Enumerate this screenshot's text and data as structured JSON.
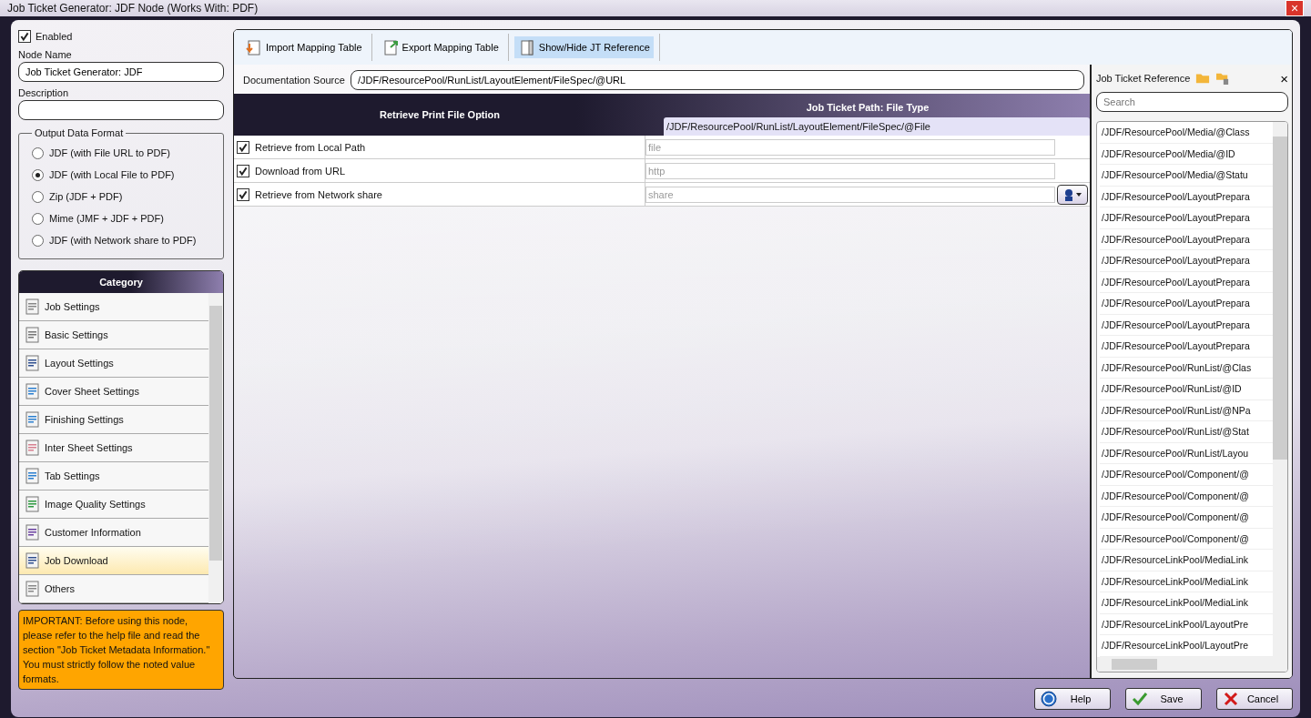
{
  "window": {
    "title": "Job Ticket Generator: JDF Node (Works With: PDF)",
    "close": "×"
  },
  "enabled": {
    "label": "Enabled",
    "checked": true
  },
  "node_name": {
    "label": "Node Name",
    "value": "Job Ticket Generator: JDF"
  },
  "description": {
    "label": "Description"
  },
  "output_format": {
    "legend": "Output Data Format",
    "options": [
      {
        "label": "JDF (with File URL to PDF)",
        "selected": false
      },
      {
        "label": "JDF (with Local File to PDF)",
        "selected": true
      },
      {
        "label": "Zip (JDF + PDF)",
        "selected": false
      },
      {
        "label": "Mime (JMF + JDF + PDF)",
        "selected": false
      },
      {
        "label": "JDF (with Network share to PDF)",
        "selected": false
      }
    ]
  },
  "category": {
    "title": "Category",
    "items": [
      {
        "label": "Job Settings",
        "selected": false
      },
      {
        "label": "Basic Settings",
        "selected": false
      },
      {
        "label": "Layout Settings",
        "selected": false
      },
      {
        "label": "Cover Sheet Settings",
        "selected": false
      },
      {
        "label": "Finishing Settings",
        "selected": false
      },
      {
        "label": "Inter Sheet Settings",
        "selected": false
      },
      {
        "label": "Tab Settings",
        "selected": false
      },
      {
        "label": "Image Quality Settings",
        "selected": false
      },
      {
        "label": "Customer Information",
        "selected": false
      },
      {
        "label": "Job Download",
        "selected": true
      },
      {
        "label": "Others",
        "selected": false
      }
    ]
  },
  "notice": "IMPORTANT: Before using this node, please refer to the help file and read the section \"Job Ticket Metadata Information.\" You must strictly follow the noted value formats.",
  "toolbar": [
    {
      "label": "Import Mapping Table",
      "selected": false
    },
    {
      "label": "Export Mapping Table",
      "selected": false
    },
    {
      "label": "Show/Hide JT Reference",
      "selected": true
    }
  ],
  "documentation_source": {
    "label": "Documentation Source",
    "value": "/JDF/ResourcePool/RunList/LayoutElement/FileSpec/@URL"
  },
  "mapping_table": {
    "columns": [
      "Retrieve Print File Option",
      "Job Ticket Path: File Type"
    ],
    "path": "/JDF/ResourcePool/RunList/LayoutElement/FileSpec/@File",
    "rows": [
      {
        "label": "Retrieve from Local Path",
        "checked": true,
        "placeholder": "file",
        "picker": false
      },
      {
        "label": "Download from URL",
        "checked": true,
        "placeholder": "http",
        "picker": false
      },
      {
        "label": "Retrieve from Network share",
        "checked": true,
        "placeholder": "share",
        "picker": true
      }
    ]
  },
  "reference": {
    "title": "Job Ticket Reference",
    "close": "×",
    "search_placeholder": "Search",
    "items": [
      "/JDF/ResourcePool/Media/@Class",
      "/JDF/ResourcePool/Media/@ID",
      "/JDF/ResourcePool/Media/@Statu",
      "/JDF/ResourcePool/LayoutPrepara",
      "/JDF/ResourcePool/LayoutPrepara",
      "/JDF/ResourcePool/LayoutPrepara",
      "/JDF/ResourcePool/LayoutPrepara",
      "/JDF/ResourcePool/LayoutPrepara",
      "/JDF/ResourcePool/LayoutPrepara",
      "/JDF/ResourcePool/LayoutPrepara",
      "/JDF/ResourcePool/LayoutPrepara",
      "/JDF/ResourcePool/RunList/@Clas",
      "/JDF/ResourcePool/RunList/@ID",
      "/JDF/ResourcePool/RunList/@NPa",
      "/JDF/ResourcePool/RunList/@Stat",
      "/JDF/ResourcePool/RunList/Layou",
      "/JDF/ResourcePool/Component/@",
      "/JDF/ResourcePool/Component/@",
      "/JDF/ResourcePool/Component/@",
      "/JDF/ResourcePool/Component/@",
      "/JDF/ResourceLinkPool/MediaLink",
      "/JDF/ResourceLinkPool/MediaLink",
      "/JDF/ResourceLinkPool/MediaLink",
      "/JDF/ResourceLinkPool/LayoutPre",
      "/JDF/ResourceLinkPool/LayoutPre"
    ]
  },
  "buttons": [
    {
      "label": "Help",
      "kind": "help"
    },
    {
      "label": "Save",
      "kind": "save"
    },
    {
      "label": "Cancel",
      "kind": "cancel"
    }
  ]
}
